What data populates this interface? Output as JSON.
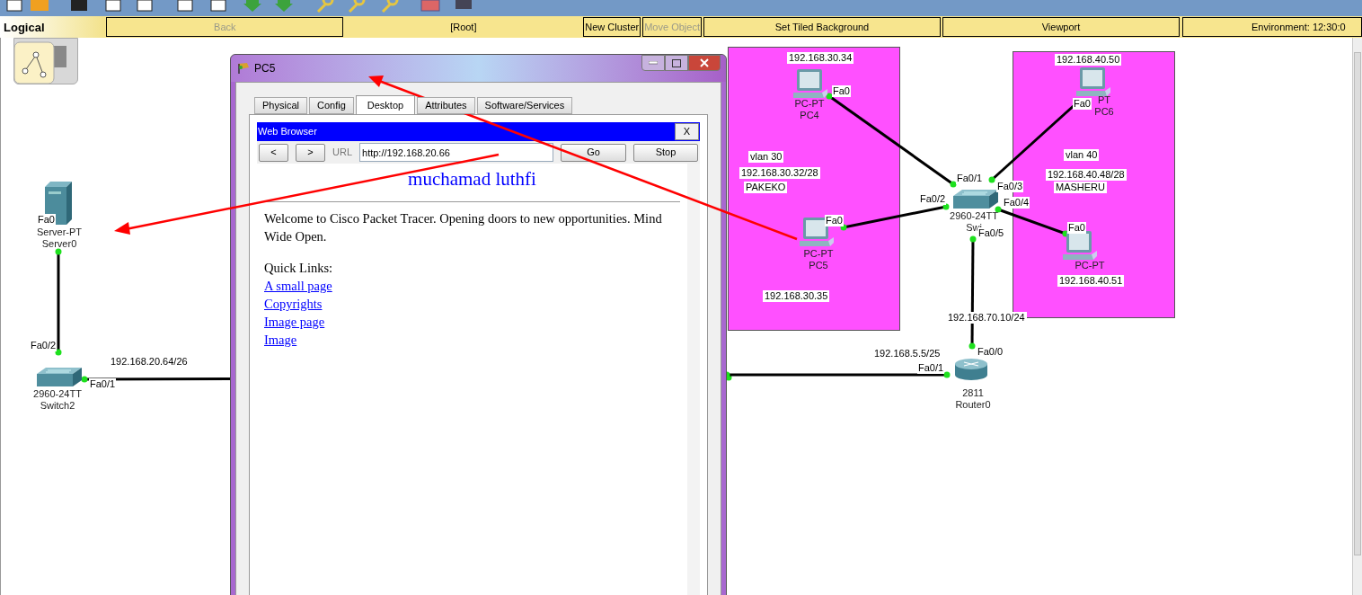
{
  "nav_bar": [
    {
      "label": "Logical",
      "kind": "mode"
    },
    {
      "label": "Back",
      "kind": "wide",
      "disabled": true
    },
    {
      "label": "[Root]",
      "kind": "plain",
      "disabled": false
    },
    {
      "label": "New Cluster",
      "kind": "small",
      "disabled": false
    },
    {
      "label": "Move Object",
      "kind": "small",
      "disabled": true
    },
    {
      "label": "Set Tiled Background",
      "kind": "wide",
      "disabled": false
    },
    {
      "label": "Viewport",
      "kind": "wide",
      "disabled": false
    },
    {
      "label": "Environment: 12:30:0",
      "kind": "edge",
      "disabled": false
    }
  ],
  "canvas": {
    "devices": [
      {
        "kind": "server",
        "model": "Server-PT",
        "name": "Server0"
      },
      {
        "kind": "switch",
        "model": "2960-24TT",
        "name": "Switch2"
      },
      {
        "kind": "pc",
        "model": "PC-PT",
        "name": "PC4"
      },
      {
        "kind": "pc",
        "model": "PC-PT",
        "name": "PC5"
      },
      {
        "kind": "pc",
        "model": "PT",
        "name": "PC6"
      },
      {
        "kind": "pc",
        "model": "PC-PT"
      },
      {
        "kind": "switch",
        "model": "2960-24TT",
        "name": "Swi"
      },
      {
        "kind": "router",
        "model": "2811",
        "name": "Router0"
      }
    ],
    "port_labels": [
      "Fa0",
      "Fa0/2",
      "Fa0/1",
      "Fa0",
      "Fa0",
      "Fa0/1",
      "Fa0/3",
      "Fa0/2",
      "Fa0/4",
      "Fa0/5",
      "Fa0",
      "Fa0",
      "Fa0/0",
      "Fa0/1"
    ],
    "network_labels": [
      "192.168.20.64/26",
      "192.168.30.34",
      "192.168.40.50",
      "vlan 30",
      "192.168.30.32/28",
      "PAKEKO",
      "192.168.30.35",
      "vlan 40",
      "192.168.40.48/28",
      "MASHERU",
      "192.168.40.51",
      "192.168.70.10/24",
      "192.168.5.5/25"
    ]
  },
  "device_window": {
    "title": "PC5",
    "tabs": [
      {
        "label": "Physical",
        "selected": false
      },
      {
        "label": "Config",
        "selected": false
      },
      {
        "label": "Desktop",
        "selected": true
      },
      {
        "label": "Attributes",
        "selected": false
      },
      {
        "label": "Software/Services",
        "selected": false
      }
    ],
    "browser": {
      "title": "Web Browser",
      "close": "X",
      "back": "<",
      "forward": ">",
      "url_label": "URL",
      "url": "http://192.168.20.66",
      "go": "Go",
      "stop": "Stop",
      "page": {
        "heading": "muchamad luthfi",
        "paragraph": "Welcome to Cisco Packet Tracer. Opening doors to new opportunities. Mind Wide Open.",
        "links_title": "Quick Links:",
        "links": [
          "A small page",
          "Copyrights",
          "Image page",
          "Image"
        ]
      }
    }
  }
}
